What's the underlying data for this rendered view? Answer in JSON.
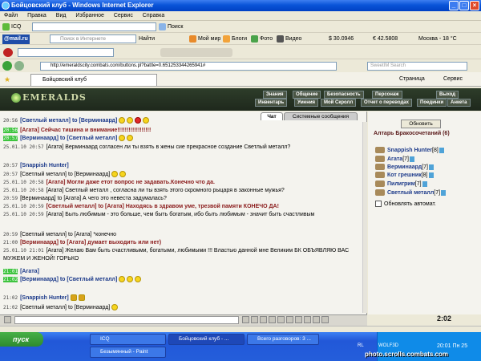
{
  "window": {
    "title": "Бойцовский клуб - Windows Internet Explorer"
  },
  "menu": [
    "Файл",
    "Правка",
    "Вид",
    "Избранное",
    "Сервис",
    "Справка"
  ],
  "toolbar1": {
    "icq": "ICQ",
    "search": "Поиск"
  },
  "toolbar2": {
    "mailru": "@mail.ru",
    "search_placeholder": "Поиск в Интернете",
    "find": "Найти",
    "items": [
      "Мой мир",
      "Блоги",
      "Фото",
      "Видео"
    ],
    "rate1": "$ 30.0946",
    "rate2": "€ 42.5808",
    "weather": "Москва - 18 °C"
  },
  "address": {
    "url": "http://emeraldscity.combats.com/buttons.pl?battle=0.651253344265941#",
    "search_placeholder": "SweetIM Search"
  },
  "tab": {
    "label": "Бойцовский клуб",
    "page": "Страница",
    "service": "Сервис"
  },
  "game": {
    "logo": "EMERALDS",
    "nav_top": [
      "Знания",
      "Общение",
      "Безопасность",
      "Персонаж",
      "Выход"
    ],
    "nav_bottom": [
      "Инвентарь",
      "Умения",
      "Мой Скролл",
      "Отчет о переводах",
      "Поединки",
      "Анкета"
    ]
  },
  "chat": {
    "tabs": [
      "Чат",
      "Системные сообщения"
    ],
    "lines": [
      {
        "time": "20:56",
        "body": "[Светлый металл] to [Верминаард]"
      },
      {
        "time": "20:56",
        "body": "[Агата] Сейчас тишина и внимание!!!!!!!!!!!!!!!!!!"
      },
      {
        "time": "20:57",
        "body": "[Верминаард] to [Светлый металл]"
      },
      {
        "time": "25.01.10 20:57",
        "body": "[Агата] Верминаард согласен ли ты взять в жены сие прекрасное создание Светлый металл?"
      },
      {
        "time": "20:57",
        "body": "[Snappish Hunter]"
      },
      {
        "time": "20:57",
        "body": "[Светлый металл] to [Верминаард]"
      },
      {
        "time": "25.01.10 20:58",
        "body": "[Агата] Могли даже етот вопрос не задавать.Конечно что да."
      },
      {
        "time": "25.01.10 20:58",
        "body": "[Агата] Светлый металл , согласна ли ты взять этого скромного рыцаря в законные мужья?"
      },
      {
        "time": "20:59",
        "body": "[Верминаард] to [Агата] А чего это невеста задумалась?"
      },
      {
        "time": "25.01.10 20:59",
        "body": "[Светлый металл] to [Агата] Находясь в здравом уме, трезвой памяти КОНЕЧО ДА!"
      },
      {
        "time": "25.01.10 20:59",
        "body": "[Агата] Быть любимым - это больше, чем быть богатым, ибо быть любимым - значит быть счастливым"
      },
      {
        "time": "20:59",
        "body": "[Светлый металл] to [Агата] *конечно"
      },
      {
        "time": "21:00",
        "body": "[Верминаард] to [Агата] думает выходить или нет)"
      },
      {
        "time": "25.01.10 21:01",
        "body": "[Агата] Желаю Вам быть счастливыми, богатыми, любимыми !!! Властью данной мне Великим БК ОБЪЯВЛЯЮ ВАС МУЖЕМ И ЖЕНОЙ! ГОРЬКО"
      },
      {
        "time": "21:01",
        "body": "[Агата]"
      },
      {
        "time": "21:02",
        "body": "[Верминаард] to [Светлый металл]"
      },
      {
        "time": "21:02",
        "body": "[Snappish Hunter]"
      },
      {
        "time": "21:02",
        "body": "[Светлый металл] to [Верминаард]"
      }
    ]
  },
  "side": {
    "refresh": "Обновить",
    "title": "Алтарь Бракосочетаний (6)",
    "players": [
      {
        "name": "Snappish Hunter",
        "level": "[8]"
      },
      {
        "name": "Агата",
        "level": "[7]"
      },
      {
        "name": "Верминаард",
        "level": "[7]"
      },
      {
        "name": "Кот грешник",
        "level": "[8]"
      },
      {
        "name": "Пилигрим",
        "level": "[7]"
      },
      {
        "name": "Светлый металл",
        "level": "[7]"
      }
    ],
    "auto": "Обновлять автомат."
  },
  "game_clock": "2:02",
  "taskbar": {
    "start": "пуск",
    "tasks": [
      "ICQ",
      "Бойцовский клуб - ...",
      "Всего разговоров: 3 ...",
      "Безымянный - Paint"
    ],
    "lang": "RL",
    "tray_label": "WOLF3D",
    "time": "20:01 Пн 25",
    "watermark": "photo.scrolls.combats.com"
  }
}
